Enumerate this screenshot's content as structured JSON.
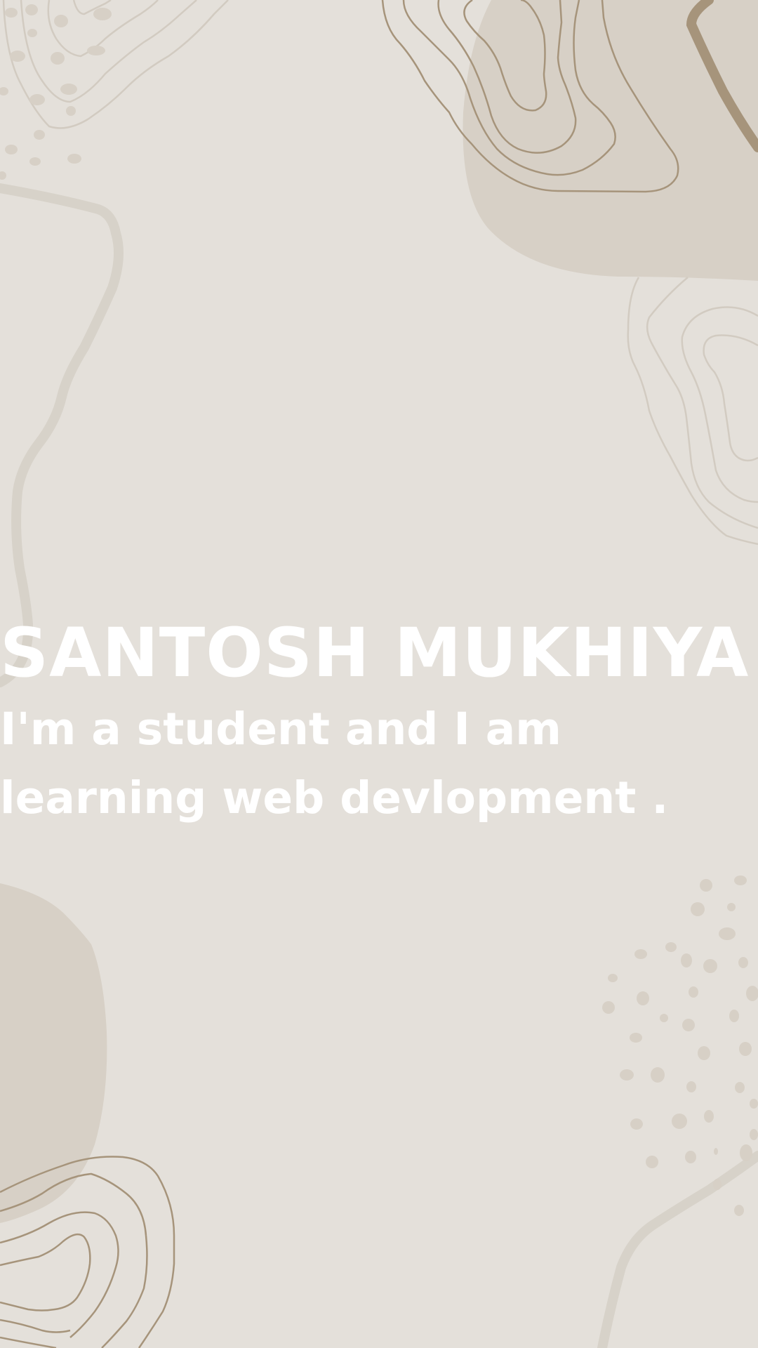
{
  "page": {
    "background_color": "#e4e0da",
    "accent_color": "#a6947b",
    "blob_color": "#d7d0c6",
    "text_color": "#ffffff"
  },
  "hero": {
    "name": "SANTOSH MUKHIYA",
    "tagline": "I'm a student and I am learning web devlopment ."
  },
  "decorations": {
    "icons": [
      "contour-lines-graphic",
      "organic-blob-shape",
      "scattered-dots-pattern"
    ]
  }
}
